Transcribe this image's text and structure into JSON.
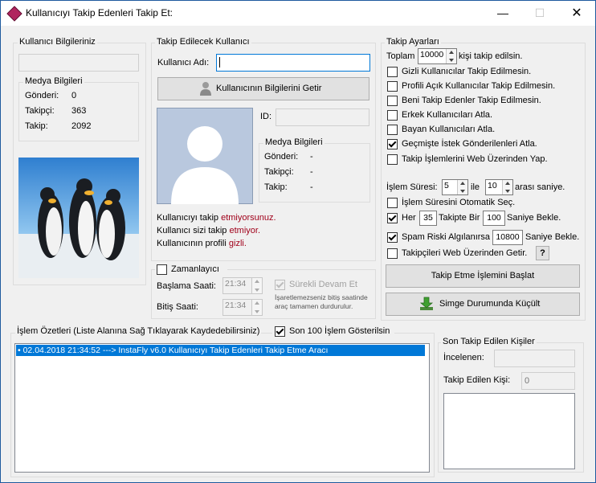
{
  "window": {
    "title": "Kullanıcıyı Takip Edenleri Takip Et:"
  },
  "user_info": {
    "group_label": "Kullanıcı Bilgileriniz",
    "username_value": "",
    "media_label": "Medya Bilgileri",
    "rows": [
      {
        "label": "Gönderi:",
        "value": "0"
      },
      {
        "label": "Takipçi:",
        "value": "363"
      },
      {
        "label": "Takip:",
        "value": "2092"
      }
    ]
  },
  "target": {
    "group_label": "Takip Edilecek Kullanıcı",
    "username_label": "Kullanıcı Adı:",
    "username_value": "",
    "fetch_button": "Kullanıcının Bilgilerini Getir",
    "id_label": "ID:",
    "id_value": "",
    "media_label": "Medya Bilgileri",
    "rows": [
      {
        "label": "Gönderi:",
        "value": "-"
      },
      {
        "label": "Takipçi:",
        "value": "-"
      },
      {
        "label": "Takip:",
        "value": "-"
      }
    ],
    "status": [
      {
        "prefix": "Kullanıcıyı takip ",
        "highlight": "etmiyorsunuz."
      },
      {
        "prefix": "Kullanıcı sizi takip ",
        "highlight": "etmiyor."
      },
      {
        "prefix": "Kullanıcının profili ",
        "highlight": "gizli."
      }
    ]
  },
  "timer": {
    "label": "Zamanlayıcı",
    "checked": false,
    "start_label": "Başlama Saati:",
    "start_value": "21:34",
    "end_label": "Bitiş Saati:",
    "end_value": "21:34",
    "continuous_label": "Sürekli Devam Et",
    "continuous_checked": true,
    "note_line1": "İşaretlemezseniz bitiş saatinde",
    "note_line2": "araç tamamen durdurulur."
  },
  "settings": {
    "group_label": "Takip Ayarları",
    "total_prefix": "Toplam",
    "total_value": "10000",
    "total_suffix": "kişi takip edilsin.",
    "options": [
      {
        "label": "Gizli Kullanıcılar Takip Edilmesin.",
        "checked": false
      },
      {
        "label": "Profili Açık Kullanıcılar Takip Edilmesin.",
        "checked": false
      },
      {
        "label": "Beni Takip Edenler Takip Edilmesin.",
        "checked": false
      },
      {
        "label": "Erkek Kullanıcıları Atla.",
        "checked": false
      },
      {
        "label": "Bayan Kullanıcıları Atla.",
        "checked": false
      },
      {
        "label": "Geçmişte İstek Gönderilenleri Atla.",
        "checked": true
      },
      {
        "label": "Takip İşlemlerini Web Üzerinden Yap.",
        "checked": false
      }
    ],
    "duration_label": "İşlem Süresi:",
    "duration_min": "5",
    "duration_and": "ile",
    "duration_max": "10",
    "duration_suffix": "arası saniye.",
    "auto_duration_label": "İşlem Süresini Otomatik Seç.",
    "auto_duration_checked": false,
    "every_label": "Her",
    "every_value": "35",
    "every_mid": "Takipte Bir",
    "every_wait": "100",
    "every_suffix": "Saniye Bekle.",
    "every_checked": true,
    "spam_label": "Spam Riski Algılanırsa",
    "spam_value": "10800",
    "spam_suffix": "Saniye Bekle.",
    "spam_checked": true,
    "web_followers_label": "Takipçileri Web Üzerinden Getir.",
    "web_followers_checked": false,
    "help_label": "?",
    "start_button": "Takip Etme İşlemini Başlat",
    "minimize_button": "Simge Durumunda Küçült"
  },
  "log": {
    "group_label": "İşlem Özetleri (Liste Alanına Sağ Tıklayarak Kaydedebilirsiniz)",
    "last100_label": "Son 100 İşlem Gösterilsin",
    "last100_checked": true,
    "entries": [
      "• 02.04.2018 21:34:52 ---> InstaFly v6.0 Kullanıcıyı Takip Edenleri Takip Etme Aracı"
    ]
  },
  "last_followed": {
    "group_label": "Son Takip Edilen Kişiler",
    "inspected_label": "İncelenen:",
    "inspected_value": "",
    "followed_label": "Takip Edilen Kişi:",
    "followed_value": "0"
  },
  "colors": {
    "accent": "#0078d7",
    "status_red": "#a0001a"
  }
}
